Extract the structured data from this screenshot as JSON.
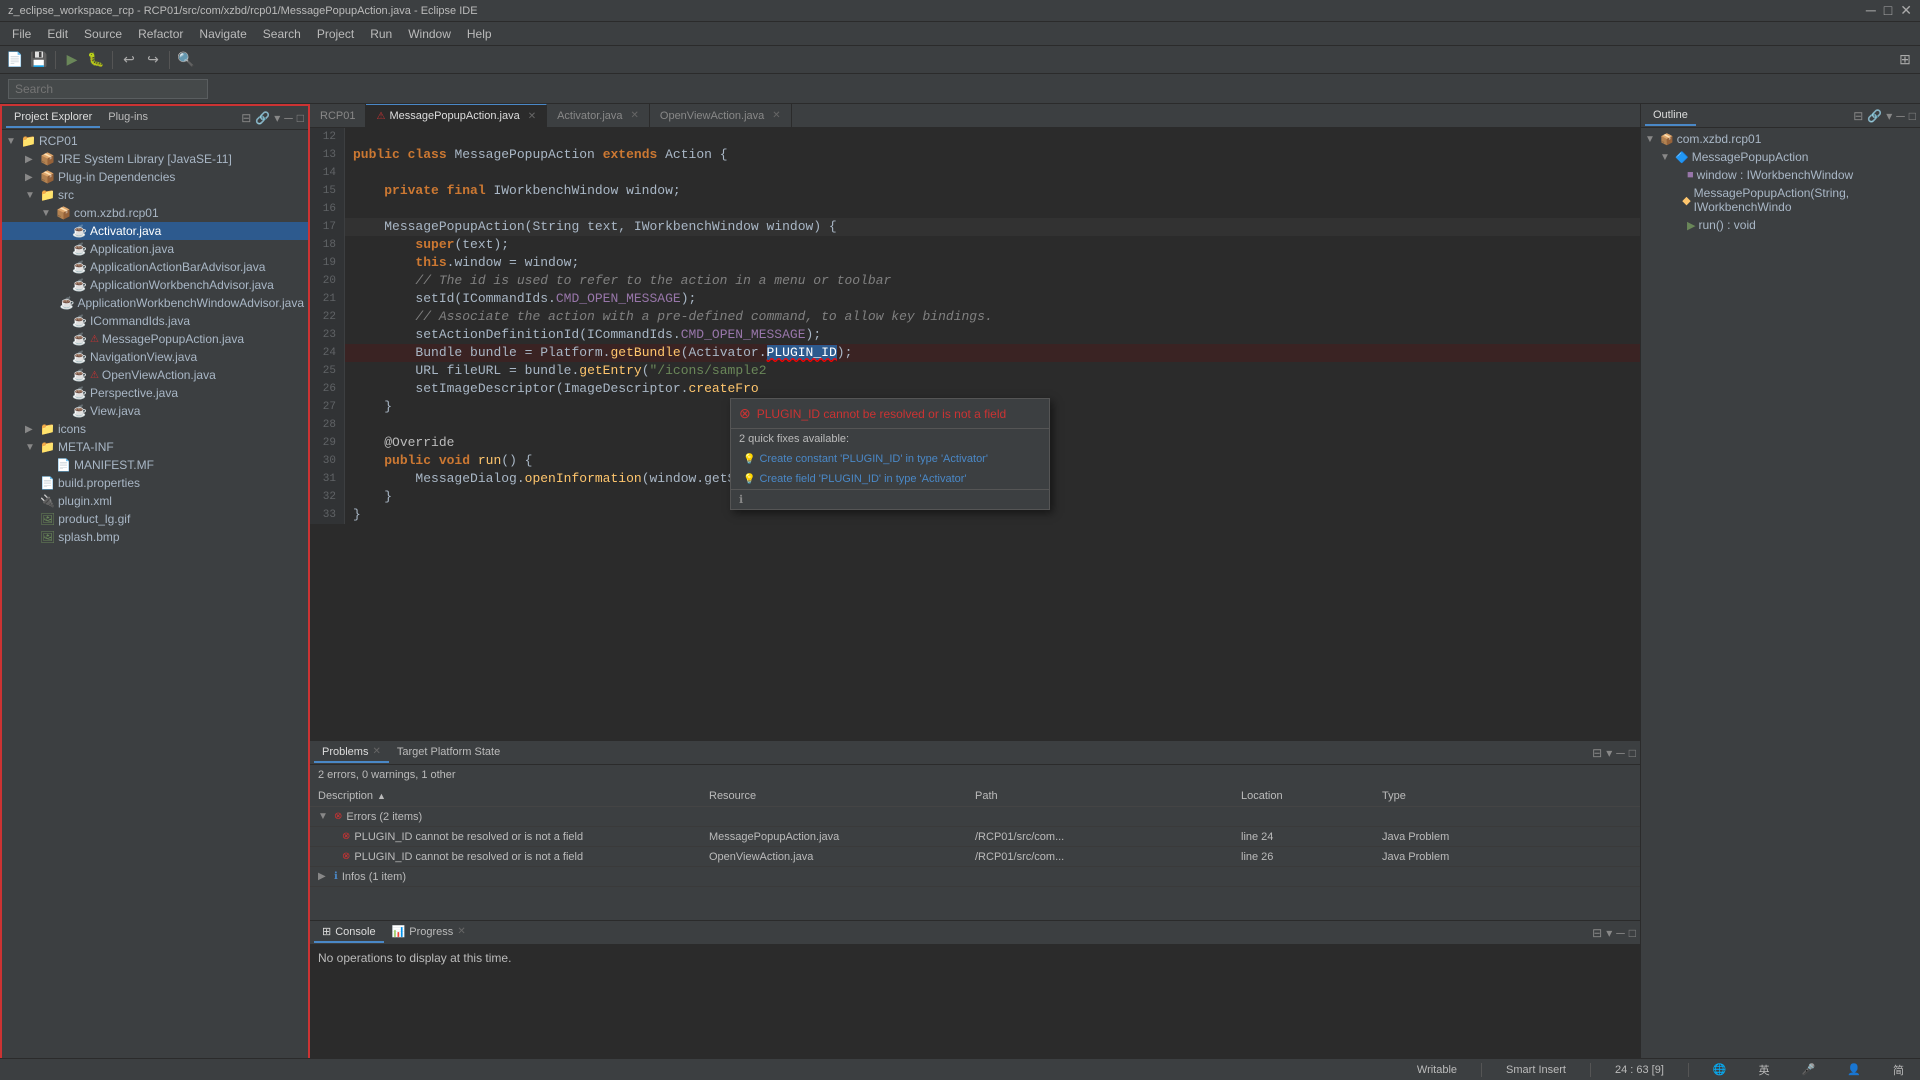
{
  "window": {
    "title": "z_eclipse_workspace_rcp - RCP01/src/com/xzbd/rcp01/MessagePopupAction.java - Eclipse IDE",
    "controls": [
      "minimize",
      "maximize",
      "close"
    ]
  },
  "menu": {
    "items": [
      "File",
      "Edit",
      "Source",
      "Refactor",
      "Navigate",
      "Search",
      "Project",
      "Run",
      "Window",
      "Help"
    ]
  },
  "search_bar": {
    "placeholder": "Search",
    "label": "Search"
  },
  "left_panel": {
    "tabs": [
      {
        "label": "Project Explorer",
        "active": true
      },
      {
        "label": "Plug-ins",
        "active": false
      }
    ],
    "tree": {
      "root": "RCP01",
      "items": [
        {
          "indent": 0,
          "label": "RCP01",
          "type": "project",
          "expanded": true
        },
        {
          "indent": 1,
          "label": "JRE System Library [JavaSE-11]",
          "type": "jar",
          "expanded": false
        },
        {
          "indent": 1,
          "label": "Plug-in Dependencies",
          "type": "jar",
          "expanded": false
        },
        {
          "indent": 1,
          "label": "src",
          "type": "folder",
          "expanded": true
        },
        {
          "indent": 2,
          "label": "com.xzbd.rcp01",
          "type": "package",
          "expanded": true
        },
        {
          "indent": 3,
          "label": "Activator.java",
          "type": "java",
          "selected": true
        },
        {
          "indent": 3,
          "label": "Application.java",
          "type": "java"
        },
        {
          "indent": 3,
          "label": "ApplicationActionBarAdvisor.java",
          "type": "java"
        },
        {
          "indent": 3,
          "label": "ApplicationWorkbenchAdvisor.java",
          "type": "java"
        },
        {
          "indent": 3,
          "label": "ApplicationWorkbenchWindowAdvisor.java",
          "type": "java"
        },
        {
          "indent": 3,
          "label": "ICommandIds.java",
          "type": "java"
        },
        {
          "indent": 3,
          "label": "MessagePopupAction.java",
          "type": "java",
          "has_error": true
        },
        {
          "indent": 3,
          "label": "NavigationView.java",
          "type": "java"
        },
        {
          "indent": 3,
          "label": "OpenViewAction.java",
          "type": "java",
          "has_error": true
        },
        {
          "indent": 3,
          "label": "Perspective.java",
          "type": "java"
        },
        {
          "indent": 3,
          "label": "View.java",
          "type": "java"
        },
        {
          "indent": 1,
          "label": "icons",
          "type": "folder",
          "expanded": false
        },
        {
          "indent": 1,
          "label": "META-INF",
          "type": "folder",
          "expanded": true
        },
        {
          "indent": 2,
          "label": "MANIFEST.MF",
          "type": "file"
        },
        {
          "indent": 1,
          "label": "build.properties",
          "type": "file"
        },
        {
          "indent": 1,
          "label": "plugin.xml",
          "type": "file"
        },
        {
          "indent": 1,
          "label": "product_lg.gif",
          "type": "image"
        },
        {
          "indent": 1,
          "label": "splash.bmp",
          "type": "image"
        }
      ]
    }
  },
  "editor": {
    "tabs": [
      {
        "label": "RCP01",
        "active": false
      },
      {
        "label": "MessagePopupAction.java",
        "active": true,
        "modified": false,
        "has_error": true
      },
      {
        "label": "Activator.java",
        "active": false
      },
      {
        "label": "OpenViewAction.java",
        "active": false
      }
    ],
    "lines": [
      {
        "num": 12,
        "content": ""
      },
      {
        "num": 13,
        "content": "public class MessagePopupAction extends Action {"
      },
      {
        "num": 14,
        "content": ""
      },
      {
        "num": 15,
        "content": "    private final IWorkbenchWindow window;"
      },
      {
        "num": 16,
        "content": ""
      },
      {
        "num": 17,
        "content": "    MessagePopupAction(String text, IWorkbenchWindow window) {"
      },
      {
        "num": 18,
        "content": "        super(text);"
      },
      {
        "num": 19,
        "content": "        this.window = window;"
      },
      {
        "num": 20,
        "content": "        // The id is used to refer to the action in a menu or toolbar"
      },
      {
        "num": 21,
        "content": "        setId(ICommandIds.CMD_OPEN_MESSAGE);"
      },
      {
        "num": 22,
        "content": "        // Associate the action with a pre-defined command, to allow key bindings."
      },
      {
        "num": 23,
        "content": "        setActionDefinitionId(ICommandIds.CMD_OPEN_MESSAGE);"
      },
      {
        "num": 24,
        "content": "        Bundle bundle = Platform.getBundle(Activator.PLUGIN_ID);",
        "error": true
      },
      {
        "num": 25,
        "content": "        URL fileURL = bundle.getEntry(\"/icons/sample2"
      },
      {
        "num": 26,
        "content": "        setImageDescriptor(ImageDescriptor.createFro"
      },
      {
        "num": 27,
        "content": "    }"
      },
      {
        "num": 28,
        "content": ""
      },
      {
        "num": 29,
        "content": "    @Override"
      },
      {
        "num": 30,
        "content": "    public void run() {"
      },
      {
        "num": 31,
        "content": "        MessageDialog.openInformation(window.getShe"
      },
      {
        "num": 32,
        "content": "    }"
      },
      {
        "num": 33,
        "content": "}"
      }
    ]
  },
  "quick_fix": {
    "header": "PLUGIN_ID cannot be resolved or is not a field",
    "subheader": "2 quick fixes available:",
    "items": [
      {
        "label": "Create constant 'PLUGIN_ID' in type 'Activator'"
      },
      {
        "label": "Create field 'PLUGIN_ID' in type 'Activator'"
      }
    ]
  },
  "bottom_panels": {
    "problems_tabs": [
      {
        "label": "Problems",
        "active": true
      },
      {
        "label": "Target Platform State",
        "active": false
      }
    ],
    "summary": "2 errors, 0 warnings, 1 other",
    "table_headers": [
      "Description",
      "Resource",
      "Path",
      "Location",
      "Type"
    ],
    "rows": [
      {
        "type": "group_error",
        "label": "Errors (2 items)",
        "expanded": true
      },
      {
        "type": "error",
        "desc": "PLUGIN_ID cannot be resolved or is not a field",
        "resource": "MessagePopupAction.java",
        "path": "/RCP01/src/com...",
        "location": "line 24",
        "issue_type": "Java Problem"
      },
      {
        "type": "error",
        "desc": "PLUGIN_ID cannot be resolved or is not a field",
        "resource": "OpenViewAction.java",
        "path": "/RCP01/src/com...",
        "location": "line 26",
        "issue_type": "Java Problem"
      },
      {
        "type": "group_info",
        "label": "Infos (1 item)",
        "expanded": false
      }
    ],
    "console_tabs": [
      {
        "label": "Console",
        "active": true
      },
      {
        "label": "Progress",
        "active": false
      }
    ],
    "console_text": "No operations to display at this time."
  },
  "outline": {
    "title": "Outline",
    "tree": [
      {
        "indent": 0,
        "label": "com.xzbd.rcp01",
        "type": "package"
      },
      {
        "indent": 1,
        "label": "MessagePopupAction",
        "type": "class",
        "expanded": true
      },
      {
        "indent": 2,
        "label": "window : IWorkbenchWindow",
        "type": "field"
      },
      {
        "indent": 2,
        "label": "MessagePopupAction(String, IWorkbenchWindo",
        "type": "method"
      },
      {
        "indent": 2,
        "label": "run() : void",
        "type": "method"
      }
    ]
  },
  "status_bar": {
    "writable": "Writable",
    "insert_mode": "Smart Insert",
    "position": "24 : 63 [9]"
  }
}
